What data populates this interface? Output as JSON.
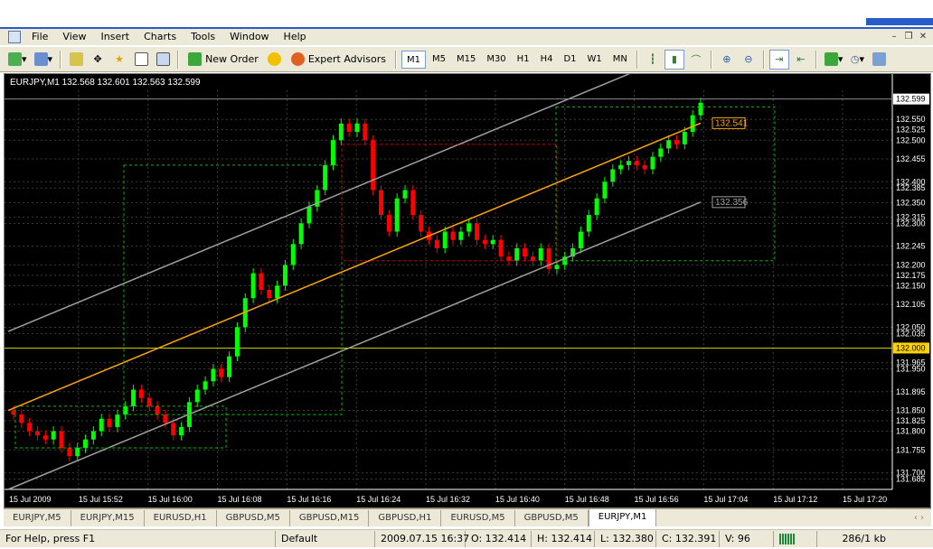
{
  "window": {
    "menu": [
      "File",
      "View",
      "Insert",
      "Charts",
      "Tools",
      "Window",
      "Help"
    ]
  },
  "toolbar": {
    "new_order": "New Order",
    "expert_advisors": "Expert Advisors",
    "timeframes": [
      "M1",
      "M5",
      "M15",
      "M30",
      "H1",
      "H4",
      "D1",
      "W1",
      "MN"
    ],
    "selected": "M1"
  },
  "chart": {
    "header": "EURJPY,M1  132.568 132.601 132.563 132.599",
    "price_axis": [
      "132.599",
      "132.550",
      "132.525",
      "132.500",
      "132.455",
      "132.400",
      "132.385",
      "132.350",
      "132.315",
      "132.300",
      "132.245",
      "132.200",
      "132.175",
      "132.150",
      "132.105",
      "132.050",
      "132.035",
      "132.000",
      "131.965",
      "131.950",
      "131.895",
      "131.850",
      "131.825",
      "131.800",
      "131.755",
      "131.700",
      "131.685"
    ],
    "time_axis": [
      "15 Jul 2009",
      "15 Jul 15:52",
      "15 Jul 16:00",
      "15 Jul 16:08",
      "15 Jul 16:16",
      "15 Jul 16:24",
      "15 Jul 16:32",
      "15 Jul 16:40",
      "15 Jul 16:48",
      "15 Jul 16:56",
      "15 Jul 17:04",
      "15 Jul 17:12",
      "15 Jul 17:20"
    ],
    "channel_labels": {
      "mid": "132.541",
      "lower": "132.356"
    },
    "current_price": "132.599",
    "hline_price": "132.000",
    "colors": {
      "bull": "#00ff00",
      "bear": "#ff0000",
      "mid_line": "#ffa500",
      "channel": "#a0a0a0",
      "grid": "#3c3c3c",
      "hline": "#c8c800"
    },
    "bars_open": [
      131.85,
      131.84,
      131.82,
      131.8,
      131.79,
      131.78,
      131.8,
      131.76,
      131.74,
      131.76,
      131.78,
      131.8,
      131.83,
      131.81,
      131.84,
      131.86,
      131.9,
      131.88,
      131.86,
      131.84,
      131.82,
      131.79,
      131.81,
      131.87,
      131.9,
      131.92,
      131.95,
      131.93,
      131.98,
      132.05,
      132.12,
      132.18,
      132.14,
      132.12,
      132.15,
      132.2,
      132.25,
      132.3,
      132.34,
      132.38,
      132.44,
      132.5,
      132.54,
      132.52,
      132.54,
      132.5,
      132.38,
      132.32,
      132.28,
      132.36,
      132.38,
      132.32,
      132.28,
      132.26,
      132.24,
      132.28,
      132.26,
      132.28,
      132.3,
      132.26,
      132.25,
      132.26,
      132.22,
      132.21,
      132.24,
      132.22,
      132.21,
      132.24,
      132.19,
      132.2,
      132.22,
      132.24,
      132.28,
      132.32,
      132.36,
      132.4,
      132.43,
      132.44,
      132.45,
      132.44,
      132.43,
      132.46,
      132.48,
      132.5,
      132.49,
      132.52,
      132.56
    ],
    "bars_close": [
      131.84,
      131.82,
      131.8,
      131.79,
      131.78,
      131.8,
      131.76,
      131.74,
      131.76,
      131.78,
      131.8,
      131.83,
      131.81,
      131.84,
      131.86,
      131.9,
      131.88,
      131.86,
      131.84,
      131.82,
      131.79,
      131.81,
      131.87,
      131.9,
      131.92,
      131.95,
      131.93,
      131.98,
      132.05,
      132.12,
      132.18,
      132.14,
      132.12,
      132.15,
      132.2,
      132.25,
      132.3,
      132.34,
      132.38,
      132.44,
      132.5,
      132.54,
      132.52,
      132.54,
      132.5,
      132.38,
      132.32,
      132.28,
      132.36,
      132.38,
      132.32,
      132.28,
      132.26,
      132.24,
      132.28,
      132.26,
      132.28,
      132.3,
      132.26,
      132.25,
      132.26,
      132.22,
      132.21,
      132.24,
      132.22,
      132.21,
      132.24,
      132.19,
      132.2,
      132.22,
      132.24,
      132.28,
      132.32,
      132.36,
      132.4,
      132.43,
      132.44,
      132.45,
      132.44,
      132.43,
      132.46,
      132.48,
      132.5,
      132.49,
      132.52,
      132.56,
      132.59
    ]
  },
  "tabs": [
    "EURJPY,M5",
    "EURJPY,M15",
    "EURUSD,H1",
    "GBPUSD,M5",
    "GBPUSD,M15",
    "GBPUSD,H1",
    "EURUSD,M5",
    "GBPUSD,M5",
    "EURJPY,M1"
  ],
  "active_tab": "EURJPY,M1",
  "status": {
    "help": "For Help, press F1",
    "profile": "Default",
    "datetime": "2009.07.15 16:37",
    "open": "O: 132.414",
    "high": "H: 132.414",
    "low": "L: 132.380",
    "close": "C: 132.391",
    "volume": "V: 96",
    "traffic": "286/1 kb"
  }
}
